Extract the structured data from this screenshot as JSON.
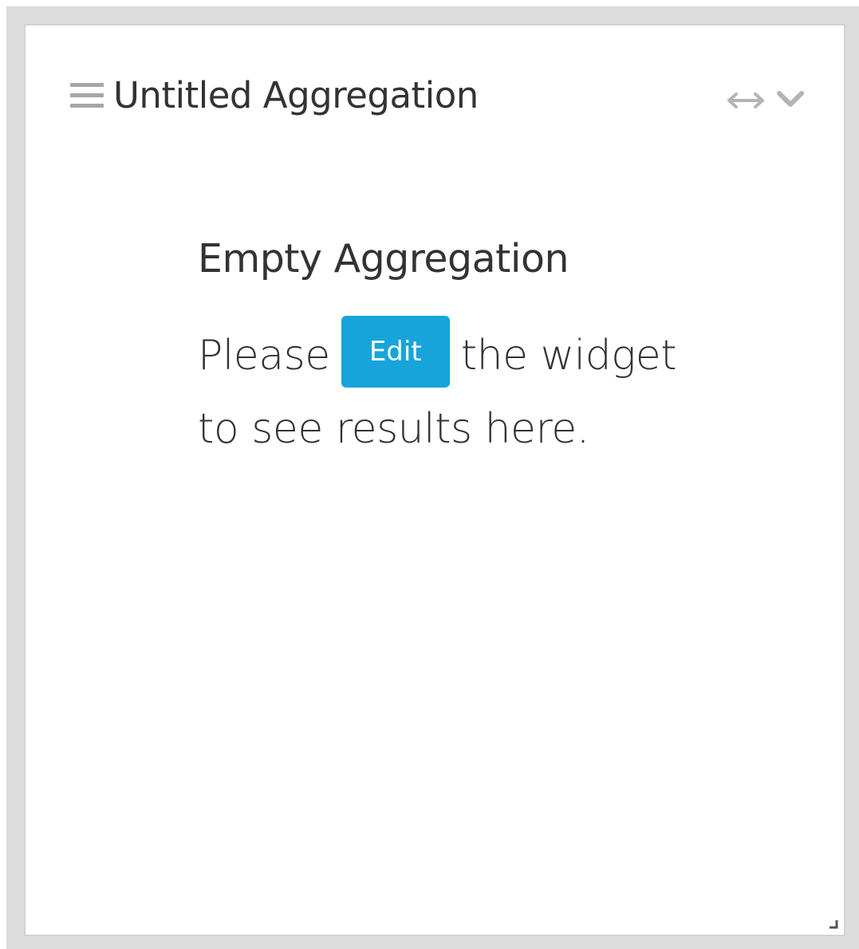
{
  "widget": {
    "title": "Untitled Aggregation",
    "icons": {
      "drag": "hamburger-icon",
      "expand": "horizontal-arrows-icon",
      "menu": "chevron-down-icon",
      "resize": "resize-corner-icon"
    }
  },
  "empty_state": {
    "heading": "Empty Aggregation",
    "text_before": "Please",
    "edit_label": "Edit",
    "text_after": "the widget",
    "text_line2": "to see results here."
  },
  "colors": {
    "accent": "#17a4db",
    "frame": "#dcdcdc",
    "icon": "#a6a6a6",
    "text": "#333333"
  }
}
